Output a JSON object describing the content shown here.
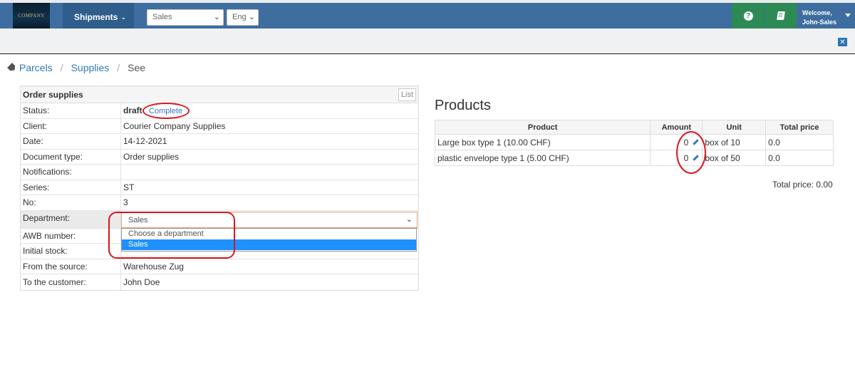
{
  "navbar": {
    "logo_text": "COMPANY",
    "shipments_label": "Shipments",
    "department_select": "Sales",
    "language_select": "Eng",
    "welcome_line1": "Welcome,",
    "welcome_line2": "John-Sales",
    "brand_color": "#3d6e9f",
    "help_color": "#2e8a55"
  },
  "breadcrumb": {
    "items": [
      "Parcels",
      "Supplies"
    ],
    "current": "See"
  },
  "order": {
    "title": "Order supplies",
    "list_button": "List",
    "status_label": "Status:",
    "status_value": "draft",
    "status_action": "Complete",
    "client_label": "Client:",
    "client_value": "Courier Company Supplies",
    "date_label": "Date:",
    "date_value": "14-12-2021",
    "doctype_label": "Document type:",
    "doctype_value": "Order supplies",
    "notifications_label": "Notifications:",
    "notifications_value": "",
    "series_label": "Series:",
    "series_value": "ST",
    "no_label": "No:",
    "no_value": "3",
    "department_label": "Department:",
    "department_value": "Sales",
    "department_options": [
      "Choose a department",
      "Sales"
    ],
    "awb_label": "AWB number:",
    "initial_stock_label": "Initial stock:",
    "source_label": "From the source:",
    "source_value": "Warehouse Zug",
    "customer_label": "To the customer:",
    "customer_value": "John Doe"
  },
  "products": {
    "title": "Products",
    "columns": [
      "Product",
      "Amount",
      "Unit",
      "Total price"
    ],
    "rows": [
      {
        "product": "Large box type 1 (10.00 CHF)",
        "amount": "0",
        "unit": "box of 10",
        "total": "0.0"
      },
      {
        "product": "plastic envelope type 1 (5.00 CHF)",
        "amount": "0",
        "unit": "box of 50",
        "total": "0.0"
      }
    ],
    "total_label": "Total price: 0.00"
  }
}
